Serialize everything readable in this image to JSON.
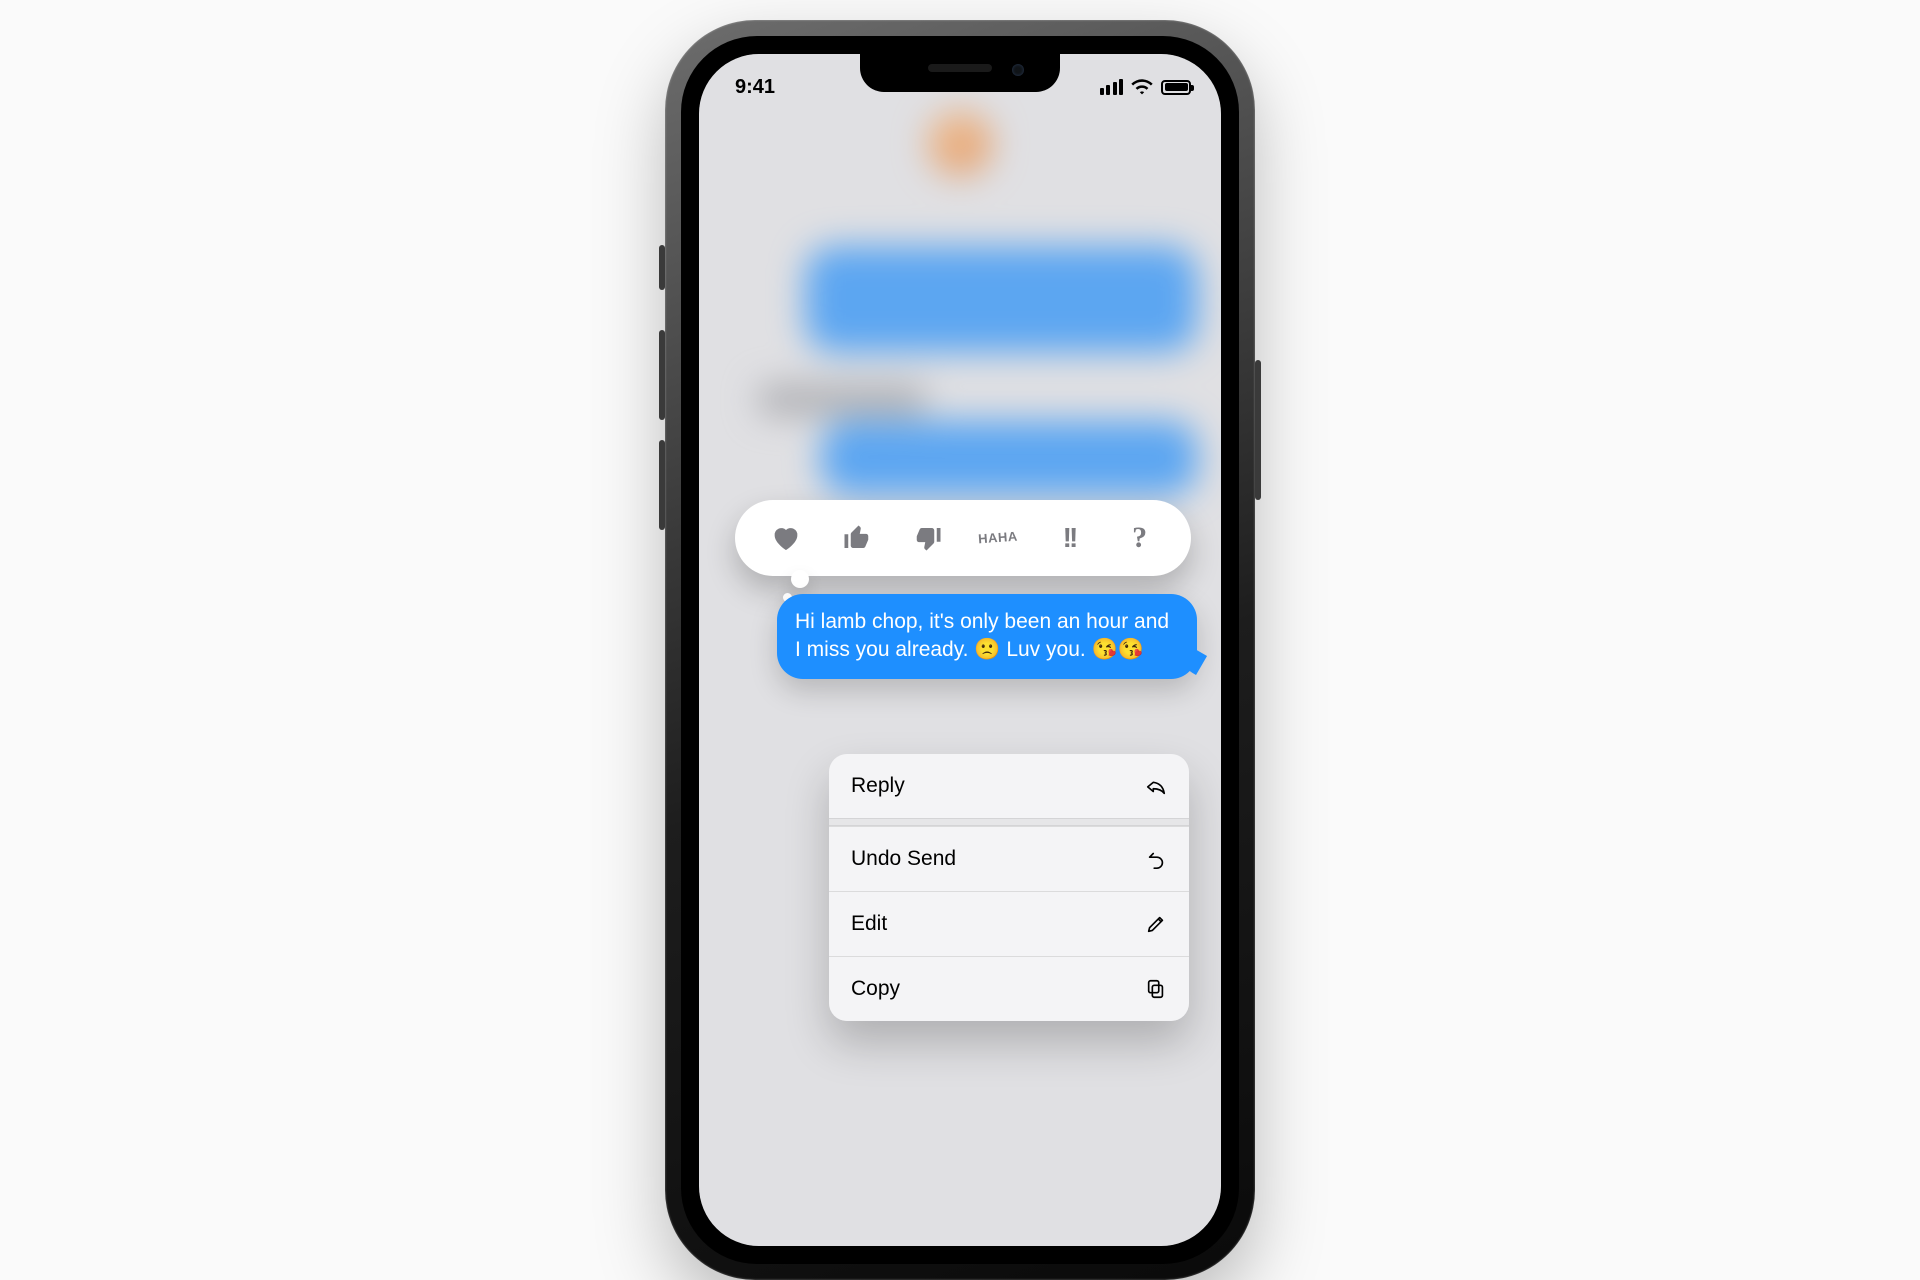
{
  "status": {
    "time": "9:41"
  },
  "tapback": {
    "heart": "heart",
    "like": "thumbs-up",
    "dislike": "thumbs-down",
    "haha_top": "HA",
    "haha_bot": "HA",
    "emphasize": "!!",
    "question": "?"
  },
  "message": {
    "text": "Hi lamb chop, it's only been an hour and I miss you already. 🙁 Luv you. 😘😘"
  },
  "menu": {
    "reply": "Reply",
    "undo_send": "Undo Send",
    "edit": "Edit",
    "copy": "Copy"
  }
}
